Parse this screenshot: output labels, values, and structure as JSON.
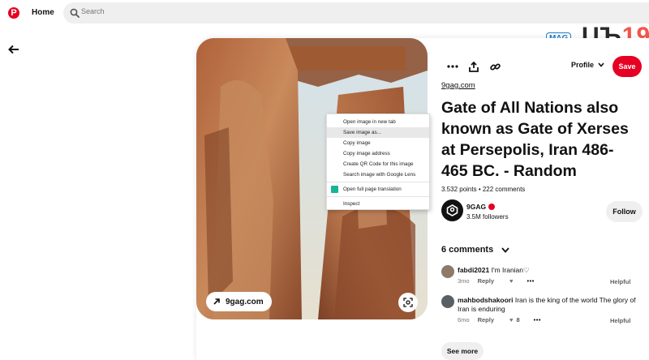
{
  "header": {
    "home_label": "Home",
    "search_placeholder": "Search"
  },
  "watermark": {
    "tag": "MAG",
    "brand_left": "UЪ",
    "brand_right": "19"
  },
  "pin": {
    "source_domain": "9gag.com",
    "source_pill_label": "9gag.com",
    "title": "Gate of All Nations also known as Gate of Xerses at Persepolis, Iran 486-465 BC. - Random",
    "stats": "3.532 points • 222 comments",
    "profile_label": "Profile",
    "save_label": "Save"
  },
  "creator": {
    "name": "9GAG",
    "followers": "3.5M followers",
    "follow_label": "Follow"
  },
  "context_menu": {
    "items": [
      "Open image in new tab",
      "Save image as...",
      "Copy image",
      "Copy image address",
      "Create QR Code for this image",
      "Search image with Google Lens",
      "Open full page translation",
      "Inspect"
    ],
    "highlighted_index": 1
  },
  "comments": {
    "header": "6 comments",
    "list": [
      {
        "user": "fabdi2021",
        "text": "I'm Iranian♡",
        "age": "3mo",
        "reply": "Reply",
        "likes": "",
        "helpful": "Helpful"
      },
      {
        "user": "mahbodshakoori",
        "text": "Iran is the king of the world The glory of Iran is enduring",
        "age": "6mo",
        "reply": "Reply",
        "likes": "8",
        "helpful": "Helpful"
      }
    ],
    "see_more": "See more"
  },
  "colors": {
    "brand_red": "#e60023",
    "pill_gray": "#efefef"
  }
}
